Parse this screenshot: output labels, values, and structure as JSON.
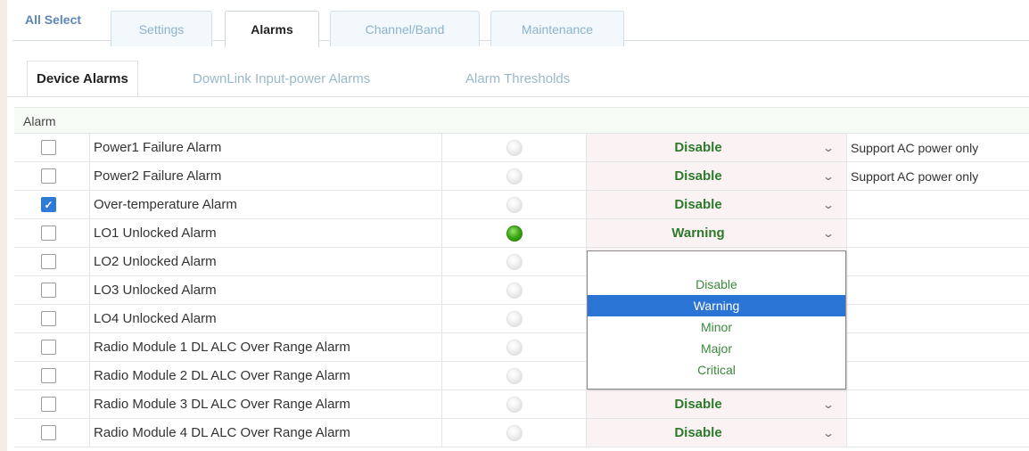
{
  "top_tabs": {
    "all_select": "All Select",
    "items": [
      "Settings",
      "Alarms",
      "Channel/Band",
      "Maintenance"
    ]
  },
  "sub_tabs": [
    "Device Alarms",
    "DownLink Input-power Alarms",
    "Alarm Thresholds"
  ],
  "table": {
    "header": "Alarm",
    "rows": [
      {
        "checked": false,
        "name": "Power1 Failure Alarm",
        "led": "off",
        "level": "Disable",
        "note": "Support AC power only"
      },
      {
        "checked": false,
        "name": "Power2 Failure Alarm",
        "led": "off",
        "level": "Disable",
        "note": "Support AC power only"
      },
      {
        "checked": true,
        "name": "Over-temperature Alarm",
        "led": "off",
        "level": "Disable",
        "note": ""
      },
      {
        "checked": false,
        "name": "LO1 Unlocked Alarm",
        "led": "green",
        "level": "Warning",
        "note": ""
      },
      {
        "checked": false,
        "name": "LO2 Unlocked Alarm",
        "led": "off",
        "level": "",
        "note": ""
      },
      {
        "checked": false,
        "name": "LO3 Unlocked Alarm",
        "led": "off",
        "level": "",
        "note": ""
      },
      {
        "checked": false,
        "name": "LO4 Unlocked Alarm",
        "led": "off",
        "level": "",
        "note": ""
      },
      {
        "checked": false,
        "name": "Radio Module 1 DL ALC Over Range Alarm",
        "led": "off",
        "level": "",
        "note": ""
      },
      {
        "checked": false,
        "name": "Radio Module 2 DL ALC Over Range Alarm",
        "led": "off",
        "level": "",
        "note": ""
      },
      {
        "checked": false,
        "name": "Radio Module 3 DL ALC Over Range Alarm",
        "led": "off",
        "level": "Disable",
        "note": ""
      },
      {
        "checked": false,
        "name": "Radio Module 4 DL ALC Over Range Alarm",
        "led": "off",
        "level": "Disable",
        "note": ""
      }
    ]
  },
  "dropdown": {
    "options": [
      "Disable",
      "Warning",
      "Minor",
      "Major",
      "Critical"
    ],
    "selected": "Warning"
  },
  "colors": {
    "accent": "#2a74d6",
    "level_text": "#2d7a2d",
    "led_on": "#3aa815"
  }
}
